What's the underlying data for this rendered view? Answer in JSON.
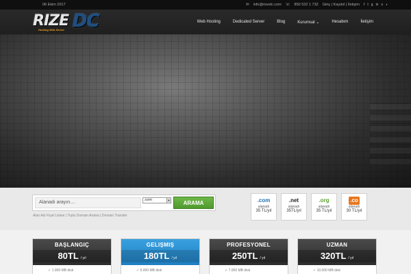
{
  "topbar": {
    "date": "06 Ekim 2017",
    "email": "info@rizedc.com",
    "phone": "850 532 1 732",
    "links": [
      "Giriş",
      "Kaydol",
      "İletişim"
    ]
  },
  "header": {
    "logo_text_1": "RIZE",
    "logo_text_2": "DC",
    "logo_tagline": "Hosting Web Server",
    "nav": [
      {
        "label": "Web Hosting"
      },
      {
        "label": "Dedicated Server"
      },
      {
        "label": "Blog"
      },
      {
        "label": "Kurumsal"
      },
      {
        "label": "Hesabım"
      },
      {
        "label": "İletişim"
      }
    ]
  },
  "domain_search": {
    "placeholder": "Alanadı arayın....",
    "tld_selected": ".com",
    "button_label": "ARAMA",
    "quick_links": [
      "Alan Adı Fiyat Listesi",
      "Toplu Domain Arama",
      "Domain Transfer"
    ]
  },
  "tlds": [
    {
      "ext": ".com",
      "label": "alanadı",
      "price": "35 TL/yıl",
      "color": "#1e6fb5"
    },
    {
      "ext": ".net",
      "label": "alanadı",
      "price": "35TL/yıl",
      "color": "#222222"
    },
    {
      "ext": ".org",
      "label": "alanadı",
      "price": "35 TL/yıl",
      "color": "#5aa02c"
    },
    {
      "ext": ".co",
      "label": "alanadı",
      "price": "30 TL/yıl",
      "color": "#e8761e"
    }
  ],
  "plans": [
    {
      "name": "BAŞLANGIÇ",
      "price": "80TL",
      "period": "/ yıl",
      "feature": "1.000 MB disk",
      "featured": false
    },
    {
      "name": "GELIŞMIŞ",
      "price": "180TL",
      "period": "/ yıl",
      "feature": "5.000 MB disk",
      "featured": true
    },
    {
      "name": "PROFESYONEL",
      "price": "250TL",
      "period": "/ yıl",
      "feature": "7.000 MB disk",
      "featured": false
    },
    {
      "name": "UZMAN",
      "price": "320TL",
      "period": "/ yıl",
      "feature": "10.000 MB disk",
      "featured": false
    }
  ],
  "colors": {
    "accent_blue": "#1e7fc0",
    "search_green": "#5aa83a"
  }
}
